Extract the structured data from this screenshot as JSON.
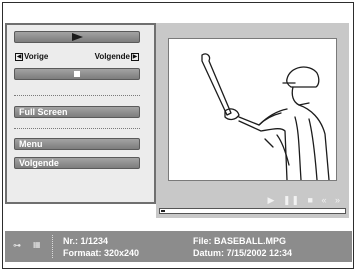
{
  "controls": {
    "prev_label": "Vorige",
    "next_label": "Volgende",
    "fullscreen_label": "Full Screen",
    "menu_label": "Menu",
    "volgende_button_label": "Volgende"
  },
  "transport": {
    "play": "▶",
    "pause": "❚❚",
    "stop": "■",
    "rewind": "«",
    "forward": "»"
  },
  "playback_progress": 0.02,
  "info": {
    "nr": "Nr.: 1/1234",
    "formaat": "Formaat: 320x240",
    "file": "File:   BASEBALL.MPG",
    "datum": "Datum:  7/15/2002 12:34"
  }
}
